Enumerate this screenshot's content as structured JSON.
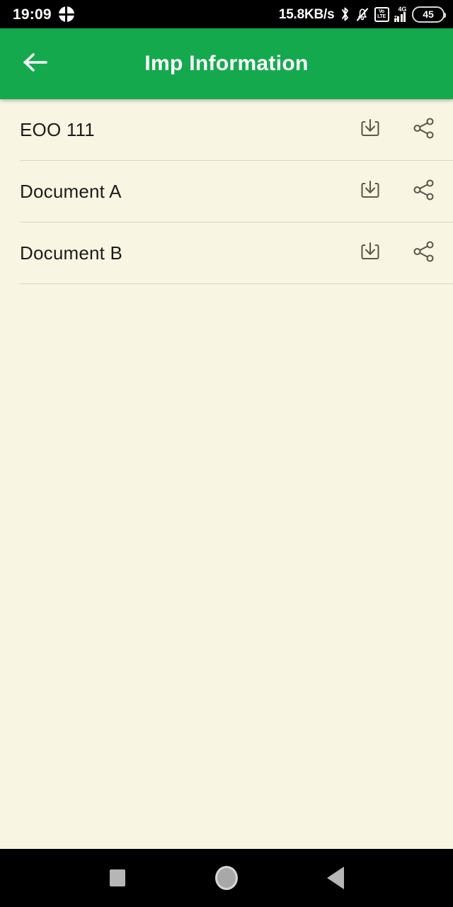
{
  "status_bar": {
    "clock": "19:09",
    "app_icon": "quadrant-circle-icon",
    "network_speed": "15.8KB/s",
    "bluetooth_icon": "bluetooth-icon",
    "silent_icon": "bell-muted-icon",
    "volte_top": "Vo",
    "volte_bottom": "LTE",
    "network_type": "4G",
    "data_arrows": "⇅",
    "signal_bars": 4,
    "battery_level": "45"
  },
  "app_bar": {
    "back_icon": "arrow-left-icon",
    "title": "Imp Information",
    "background_color": "#15a94e",
    "title_color": "#ffffff"
  },
  "theme": {
    "page_background": "#f8f6e3",
    "divider_color": "#d9d7c4",
    "text_color": "#1c1c1c",
    "icon_color": "#5c5a4e"
  },
  "documents": {
    "download_icon": "download-icon",
    "share_icon": "share-icon",
    "items": [
      {
        "title": "EOO 111"
      },
      {
        "title": "Document A"
      },
      {
        "title": "Document B"
      }
    ]
  },
  "nav_bar": {
    "recents_icon": "square-recents-icon",
    "home_icon": "circle-home-icon",
    "back_icon": "triangle-back-icon"
  }
}
